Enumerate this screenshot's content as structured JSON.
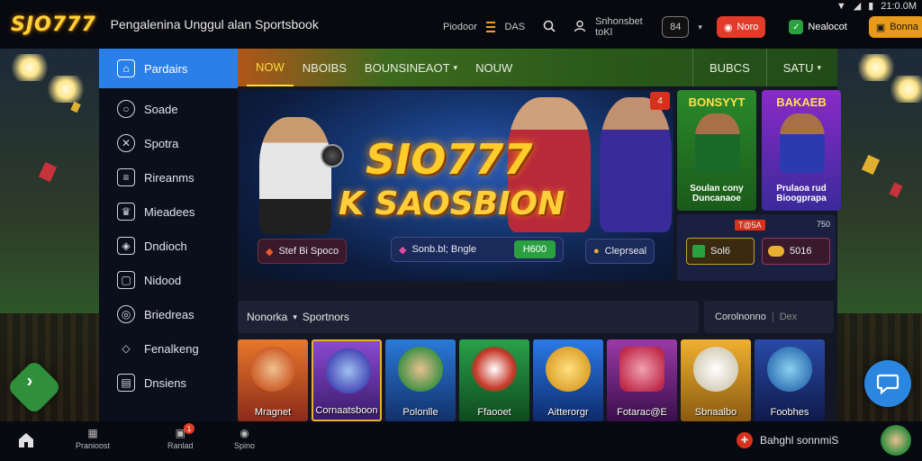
{
  "header": {
    "logo": "SJO777",
    "tagline": "Pengalenina Unggul alan Sportsbook",
    "nav_link_1": "Piodoor",
    "nav_link_2": "DAS",
    "user_label": "Snhonsbet toKl",
    "counter": "84",
    "red_button": "Noro",
    "green_button": "Nealocot",
    "orange_button": "Bonna",
    "status_time": "21:0.0M"
  },
  "sidebar": {
    "items": [
      {
        "label": "Pardairs",
        "icon": "home-icon"
      },
      {
        "label": "Soade",
        "icon": "circle-icon"
      },
      {
        "label": "Spotra",
        "icon": "x-icon"
      },
      {
        "label": "Rireanms",
        "icon": "list-icon"
      },
      {
        "label": "Mieadees",
        "icon": "trophy-icon"
      },
      {
        "label": "Dndioch",
        "icon": "shield-icon"
      },
      {
        "label": "Nidood",
        "icon": "cube-icon"
      },
      {
        "label": "Briedreas",
        "icon": "target-icon"
      },
      {
        "label": "Fenalkeng",
        "icon": "diamond-icon"
      },
      {
        "label": "Dnsiens",
        "icon": "document-icon"
      }
    ]
  },
  "tabs": {
    "left": [
      "NOW",
      "NBOIBS",
      "BOUNSINEAOT",
      "NOUW"
    ],
    "right": [
      "BUBCS",
      "SATU"
    ]
  },
  "hero": {
    "title": "SIO777",
    "subtitle": "K SAOSBION",
    "btn_1": "Stef Bi Spoco",
    "btn_2": "Sonb.bl; Bngle",
    "btn_2_amount": "H600",
    "btn_3": "Cleprseal",
    "badge": "4"
  },
  "promos": [
    {
      "title": "BONSYYT",
      "label": "Soulan cony Duncanaoe"
    },
    {
      "title": "BAKAEB",
      "label": "Prulaoa rud Bioogprapa"
    }
  ],
  "promo_row": {
    "badge_left": "T@5A",
    "badge_right": "750",
    "btn_left": "Sol6",
    "btn_right": "5016"
  },
  "search": {
    "prefix": "Nonorka",
    "value": "Sportnors"
  },
  "filter": {
    "label": "Corolnonno",
    "value": "Dex"
  },
  "games": [
    {
      "label": "Mragnet",
      "color": "#d8541a"
    },
    {
      "label": "Cornaatsboon",
      "color": "#6a3aa8"
    },
    {
      "label": "Polonlle",
      "color": "#1e5ab0"
    },
    {
      "label": "Ffaooet",
      "color": "#1e8a3a"
    },
    {
      "label": "Aitterorgr",
      "color": "#1e58c8"
    },
    {
      "label": "Fotarac@E",
      "color": "#7a2a8a"
    },
    {
      "label": "Sbnaalbo",
      "color": "#d89a20"
    },
    {
      "label": "Foobhes",
      "color": "#1a3a80"
    }
  ],
  "bottom": {
    "item_1": "Pranioost",
    "item_2": "Ranlad",
    "item_2_badge": "1",
    "item_3": "Spino",
    "right_label": "Bahghl sonnmiS"
  }
}
